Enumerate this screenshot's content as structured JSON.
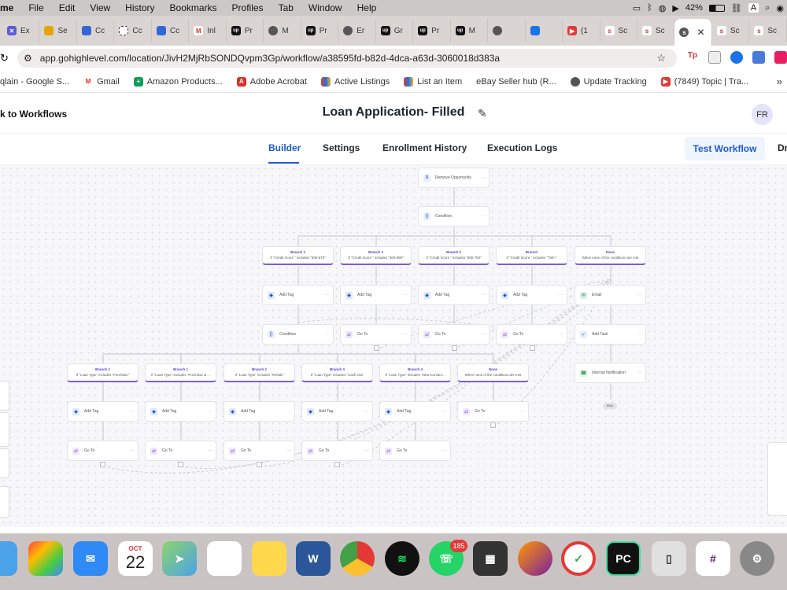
{
  "menubar": {
    "items": [
      "me",
      "File",
      "Edit",
      "View",
      "History",
      "Bookmarks",
      "Profiles",
      "Tab",
      "Window",
      "Help"
    ],
    "battery": "42%"
  },
  "tabs": [
    {
      "label": "Ex",
      "color": "#5b5bd6"
    },
    {
      "label": "Se",
      "color": "#e5a50a"
    },
    {
      "label": "Cc",
      "color": "#3367d6"
    },
    {
      "label": "Cc",
      "color": "#222"
    },
    {
      "label": "Cc",
      "color": "#3367d6"
    },
    {
      "label": "Inl",
      "color": "#d93025"
    },
    {
      "label": "Pr",
      "color": "#111"
    },
    {
      "label": "M",
      "color": "#555"
    },
    {
      "label": "Pr",
      "color": "#111"
    },
    {
      "label": "Er",
      "color": "#555"
    },
    {
      "label": "Gr",
      "color": "#111"
    },
    {
      "label": "Pr",
      "color": "#111"
    },
    {
      "label": "M",
      "color": "#111"
    },
    {
      "label": "",
      "color": "#555"
    },
    {
      "label": "",
      "color": "#1a73e8"
    },
    {
      "label": "(1",
      "color": "#e53935"
    },
    {
      "label": "Sc",
      "color": "#c0392b"
    },
    {
      "label": "Sc",
      "color": "#c0392b"
    },
    {
      "label": "",
      "color": "#c0392b"
    },
    {
      "label": "Sc",
      "color": "#c0392b"
    },
    {
      "label": "Sc",
      "color": "#c0392b"
    }
  ],
  "active_tab_index": 18,
  "url": "app.gohighlevel.com/location/JivH2MjRbSONDQvpm3Gp/workflow/a38595fd-b82d-4dca-a63d-3060018d383a",
  "bookmarks": [
    "qlain - Google S...",
    "Gmail",
    "Amazon Products...",
    "Adobe Acrobat",
    "Active Listings",
    "List an Item",
    "eBay Seller hub (R...",
    "Update Tracking",
    "(7849) Topic | Tra..."
  ],
  "header": {
    "back": "k to Workflows",
    "title": "Loan Application- Filled",
    "avatar": "FR"
  },
  "nav": {
    "tabs": [
      "Builder",
      "Settings",
      "Enrollment History",
      "Execution Logs"
    ],
    "test": "Test Workflow",
    "extra": "Dr"
  },
  "nodes": {
    "remove_opp": "Remove Opportunity",
    "condition": "Condition",
    "add_tag": "Add Tag",
    "go_to": "Go To",
    "email": "Email",
    "add_task": "Add Task",
    "internal": "Internal Notification",
    "end": "END"
  },
  "branches_top": [
    {
      "title": "Branch 1",
      "cond": "If \"Credit Score \" includes \"600-679\""
    },
    {
      "title": "Branch 2",
      "cond": "If \"Credit Score \" includes \"300-599\""
    },
    {
      "title": "Branch 3",
      "cond": "If \"Credit Score \" includes \"680-750\""
    },
    {
      "title": "Branch",
      "cond": "If \"Credit Score \" includes \"750+\""
    },
    {
      "title": "None",
      "cond": "When none of the conditions are met"
    }
  ],
  "branches_bottom": [
    {
      "title": "Branch 1",
      "cond": "If \"Loan Type\" includes \"Purchase\""
    },
    {
      "title": "Branch 1",
      "cond": "If \"Loan Type\" includes \"Purchase & ..."
    },
    {
      "title": "Branch 2",
      "cond": "If \"Loan Type\" includes \"Rehab\""
    },
    {
      "title": "Branch 3",
      "cond": "If \"Loan Type\" includes \"Cash Out\""
    },
    {
      "title": "Branch 4",
      "cond": "If \"Loan Type\" includes \"New Constru..."
    },
    {
      "title": "None",
      "cond": "When none of the conditions are met"
    }
  ],
  "dock": {
    "calendar_month": "OCT",
    "calendar_day": "22",
    "whatsapp_badge": "185",
    "word": "W",
    "pycharm": "PC"
  }
}
